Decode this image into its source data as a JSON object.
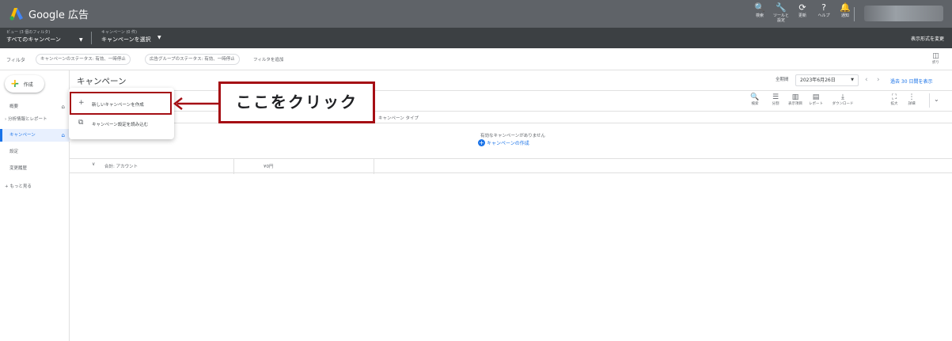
{
  "topbar": {
    "title": "Google 広告",
    "icons": [
      {
        "name": "search-icon",
        "glyph": "🔍",
        "label": "検索"
      },
      {
        "name": "tools-icon",
        "glyph": "🔧",
        "label": "ツールと設定"
      },
      {
        "name": "refresh-icon",
        "glyph": "⟳",
        "label": "更新"
      },
      {
        "name": "help-icon",
        "glyph": "?",
        "label": "ヘルプ"
      },
      {
        "name": "bell-icon",
        "glyph": "🔔",
        "label": "通知"
      }
    ]
  },
  "subbar": {
    "view_small": "ビュー (3 個のフィルタ)",
    "view_value": "すべてのキャンペーン",
    "campaign_small": "キャンペーン (0 件)",
    "campaign_value": "キャンペーンを選択",
    "display_change": "表示形式を変更"
  },
  "filterbar": {
    "label": "フィルタ",
    "chips": [
      "キャンペーンのステータス: 有効、一時停止",
      "広告グループのステータス: 有効、一時停止"
    ],
    "add_filter": "フィルタを追加",
    "collapse_label": "折り"
  },
  "sidebar": {
    "create_label": "作成",
    "items": [
      {
        "label": "概要",
        "home": true
      },
      {
        "label": "› 分析情報とレポート",
        "home": false
      },
      {
        "label": "キャンペーン",
        "home": true
      },
      {
        "label": "設定",
        "home": false
      },
      {
        "label": "変更履歴",
        "home": false
      },
      {
        "label": "+ もっと見る",
        "home": false
      }
    ]
  },
  "main": {
    "title": "キャンペーン",
    "date_label": "全期間",
    "date_value": "2023年6月26日",
    "last30": "過去 30 日間を表示",
    "tools": [
      {
        "name": "search-tool-icon",
        "glyph": "🔍",
        "label": "検索"
      },
      {
        "name": "segment-icon",
        "glyph": "☰",
        "label": "分割"
      },
      {
        "name": "columns-icon",
        "glyph": "▥",
        "label": "表示項目"
      },
      {
        "name": "report-icon",
        "glyph": "▤",
        "label": "レポート"
      },
      {
        "name": "download-icon",
        "glyph": "⤓",
        "label": "ダウンロード"
      },
      {
        "name": "expand-icon",
        "glyph": "⛶",
        "label": "拡大"
      },
      {
        "name": "more-icon",
        "glyph": "⋮",
        "label": "詳細"
      }
    ],
    "column_type": "キャンペーン タイプ",
    "empty_text": "有効なキャンペーンがありません",
    "empty_link": "キャンペーンの作成",
    "total_label": "合計: アカウント",
    "total_value": "¥0円"
  },
  "dropdown": {
    "items": [
      {
        "icon": "+",
        "label": "新しいキャンペーンを作成"
      },
      {
        "icon": "⧉",
        "label": "キャンペーン設定を読み込む"
      }
    ]
  },
  "callout": {
    "text": "ここをクリック"
  },
  "colors": {
    "accent": "#1a73e8",
    "callout_border": "#a50e14"
  }
}
